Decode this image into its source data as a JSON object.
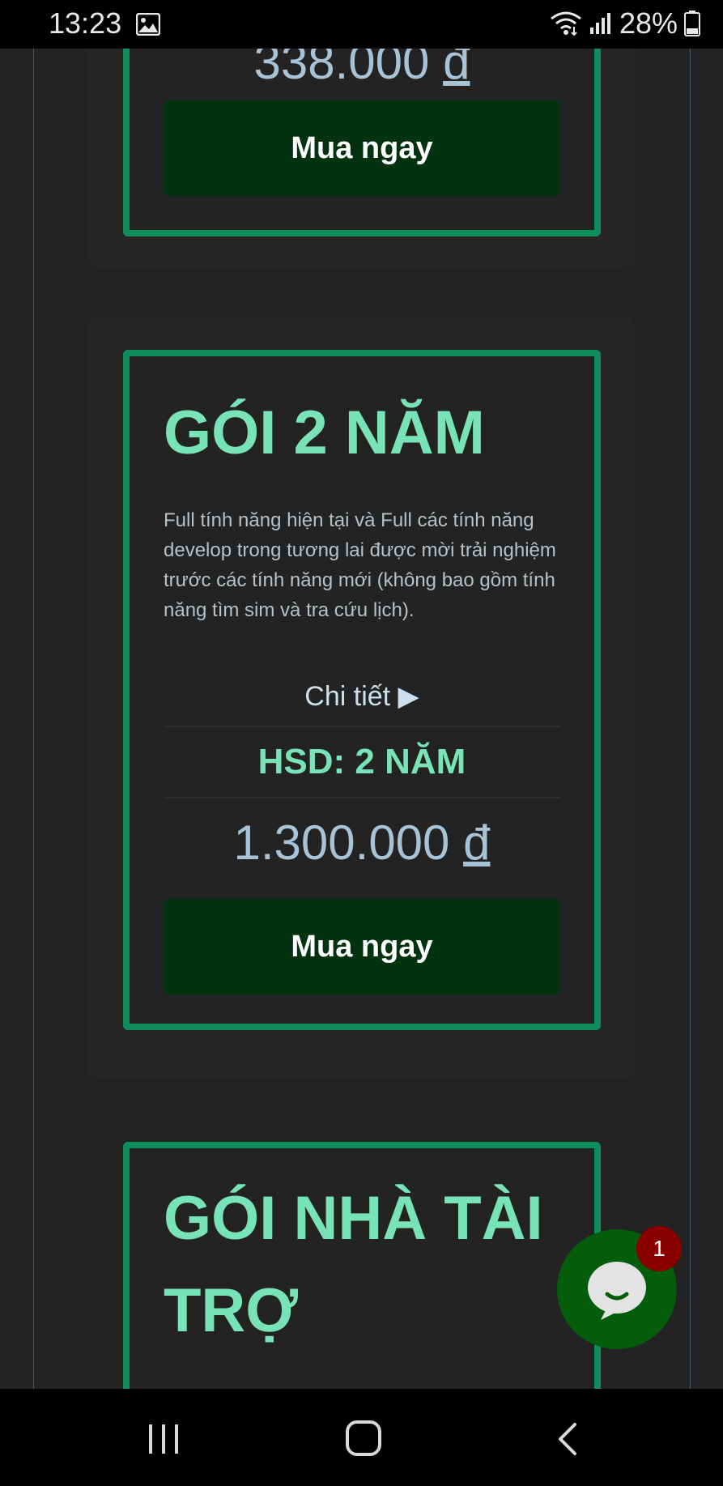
{
  "status_bar": {
    "time": "13:23",
    "battery": "28%",
    "icons": [
      "image-icon",
      "wifi-icon",
      "signal-icon",
      "battery-icon"
    ]
  },
  "prev_card": {
    "price": "338.000",
    "currency": "đ",
    "buy_label": "Mua ngay"
  },
  "card_2y": {
    "title": "GÓI 2 NĂM",
    "description": "Full tính năng hiện tại và Full các tính năng develop trong tương lai được mời trải nghiệm trước các tính năng mới (không bao gồm tính năng tìm sim và tra cứu lịch).",
    "details_label": "Chi tiết ▶",
    "hsd": "HSD: 2 NĂM",
    "price": "1.300.000",
    "currency": "đ",
    "buy_label": "Mua ngay"
  },
  "card_sponsor": {
    "title_line1": "GÓI NHÀ TÀI",
    "title_line2": "TRỢ"
  },
  "chat": {
    "badge": "1"
  },
  "colors": {
    "accent_green": "#78e3b9",
    "border_green": "#0f8d5c",
    "button_bg": "#03320f",
    "chat_bg": "#035d0b",
    "badge_bg": "#8a0000",
    "background": "#232323"
  }
}
